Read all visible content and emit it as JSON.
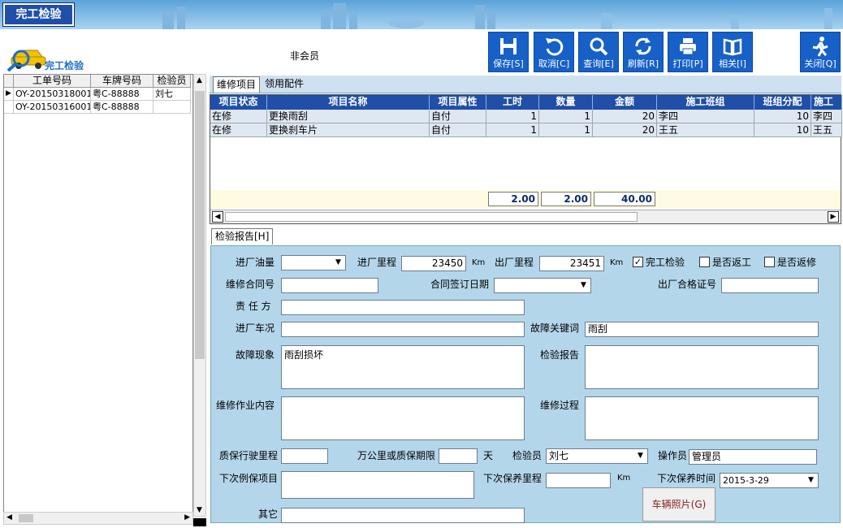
{
  "window": {
    "title": "完工检验"
  },
  "header": {
    "logo_text": "完工检验",
    "member_status": "非会员"
  },
  "toolbar": [
    {
      "icon": "save-icon",
      "label": "保存[S]"
    },
    {
      "icon": "undo-icon",
      "label": "取消[C]"
    },
    {
      "icon": "search-icon",
      "label": "查询[E]"
    },
    {
      "icon": "refresh-icon",
      "label": "刷新[R]"
    },
    {
      "icon": "print-icon",
      "label": "打印[P]"
    },
    {
      "icon": "book-icon",
      "label": "相关[I]"
    },
    {
      "icon": "exit-icon",
      "label": "关闭[Q]"
    }
  ],
  "left_list": {
    "columns": [
      "工单号码",
      "车牌号码",
      "检验员"
    ],
    "rows": [
      [
        "OY-20150318001",
        "粤C-88888",
        "刘七"
      ],
      [
        "OY-20150316001",
        "粤C-88888",
        ""
      ]
    ]
  },
  "tabs": {
    "repair": "维修项目",
    "parts": "领用配件",
    "report": "检验报告[H]"
  },
  "grid": {
    "columns": [
      "项目状态",
      "项目名称",
      "项目属性",
      "工时",
      "数量",
      "金额",
      "施工班组",
      "班组分配",
      "施工"
    ],
    "rows": [
      [
        "在修",
        "更换雨刮",
        "自付",
        "1",
        "1",
        "20",
        "李四",
        "10",
        "李四"
      ],
      [
        "在修",
        "更换刹车片",
        "自付",
        "1",
        "1",
        "20",
        "王五",
        "10",
        "王五"
      ]
    ],
    "totals": {
      "hours": "2.00",
      "qty": "2.00",
      "amount": "40.00"
    }
  },
  "form": {
    "fuel_label": "进厂油量",
    "fuel_value": "",
    "in_mileage_label": "进厂里程",
    "in_mileage_value": "23450",
    "km1": "Km",
    "out_mileage_label": "出厂里程",
    "out_mileage_value": "23451",
    "km2": "Km",
    "done_check_label": "完工检验",
    "done_check_mark": "✓",
    "rework_label": "是否返工",
    "return_label": "是否返修",
    "contract_label": "维修合同号",
    "contract_value": "",
    "contract_date_label": "合同签订日期",
    "contract_date_value": "",
    "cert_label": "出厂合格证号",
    "cert_value": "",
    "resp_label": "责 任 方",
    "resp_value": "",
    "in_condition_label": "进厂车况",
    "in_condition_value": "",
    "fault_key_label": "故障关键词",
    "fault_key_value": "雨刮",
    "fault_label": "故障现象",
    "fault_value": "雨刮损坏",
    "report_label": "检验报告",
    "report_value": "",
    "work_label": "维修作业内容",
    "work_value": "",
    "process_label": "维修过程",
    "process_value": "",
    "warranty_label": "质保行驶里程",
    "warranty_value": "",
    "period_label": "万公里或质保期限",
    "period_value": "",
    "days": "天",
    "inspector_label": "检验员",
    "inspector_value": "刘七",
    "operator_label": "操作员",
    "operator_value": "管理员",
    "next_item_label": "下次例保项目",
    "next_item_value": "",
    "next_mileage_label": "下次保养里程",
    "next_mileage_value": "",
    "km3": "Km",
    "next_time_label": "下次保养时间",
    "next_time_value": "2015-3-29",
    "other_label": "其它",
    "other_value": "",
    "photo_button": "车辆照片(G)"
  }
}
